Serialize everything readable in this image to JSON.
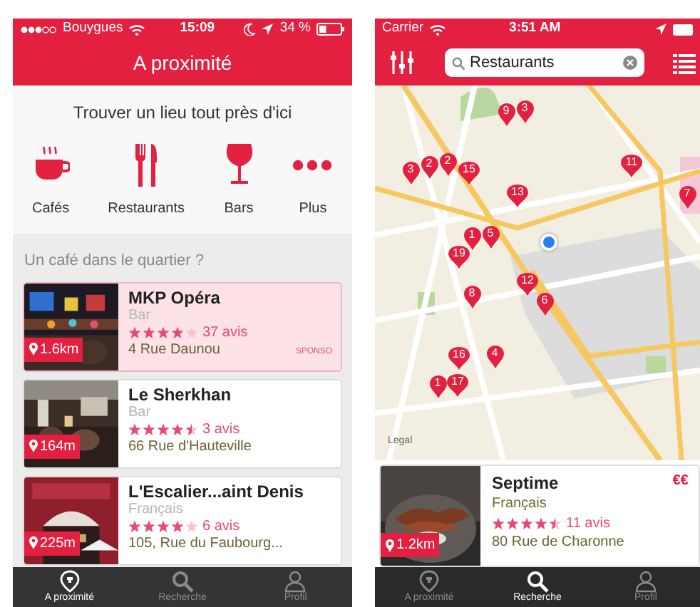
{
  "left_screen": {
    "status_bar": {
      "carrier": "Bouygues",
      "time": "15:09",
      "battery": "34 %"
    },
    "title": "A proximité",
    "prompt": "Trouver un lieu tout près d'ici",
    "categories": [
      {
        "kind": "cafe",
        "label": "Cafés"
      },
      {
        "kind": "restaurant",
        "label": "Restaurants"
      },
      {
        "kind": "bar",
        "label": "Bars"
      },
      {
        "kind": "more",
        "label": "Plus"
      }
    ],
    "section_title": "Un café dans le quartier ?",
    "places": [
      {
        "name": "MKP Opéra",
        "category": "Bar",
        "stars": 4,
        "reviews": "37 avis",
        "address": "4 Rue Daunou",
        "distance": "1.6km",
        "sponsored": true,
        "sponsor_label": "SPONSO"
      },
      {
        "name": "Le Sherkhan",
        "category": "Bar",
        "stars": 4.5,
        "reviews": "3 avis",
        "address": "66 Rue d'Hauteville",
        "distance": "164m",
        "sponsored": false
      },
      {
        "name": "L'Escalier...aint Denis",
        "category": "Français",
        "stars": 4,
        "reviews": "6 avis",
        "address": "105, Rue du Faubourg...",
        "distance": "225m",
        "sponsored": false
      }
    ],
    "tab_bar": [
      {
        "kind": "nearby",
        "label": "A proximité",
        "selected": true
      },
      {
        "kind": "search",
        "label": "Recherche",
        "selected": false
      },
      {
        "kind": "profile",
        "label": "Profil",
        "selected": false
      }
    ]
  },
  "right_screen": {
    "status_bar": {
      "carrier": "Carrier",
      "time": "3:51 AM"
    },
    "search": {
      "value": "Restaurants"
    },
    "map": {
      "pins": [
        "9",
        "3",
        "3",
        "2",
        "2",
        "15",
        "11",
        "13",
        "7",
        "1",
        "5",
        "19",
        "12",
        "8",
        "6",
        "16",
        "4",
        "1",
        "17"
      ],
      "legal": "Legal"
    },
    "place": {
      "name": "Septime",
      "price": "€€",
      "category": "Français",
      "stars": 4.5,
      "reviews": "11 avis",
      "address": "80 Rue de Charonne",
      "distance": "1.2km"
    },
    "tab_bar": [
      {
        "kind": "nearby",
        "label": "A proximité",
        "selected": false
      },
      {
        "kind": "search",
        "label": "Recherche",
        "selected": true
      },
      {
        "kind": "profile",
        "label": "Profil",
        "selected": false
      }
    ]
  }
}
